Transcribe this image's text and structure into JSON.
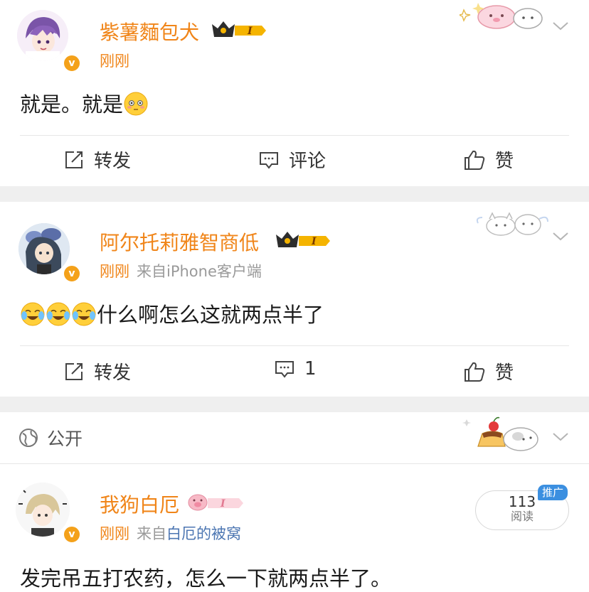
{
  "posts": [
    {
      "username": "紫薯麵包犬",
      "vip_level": "I",
      "time": "刚刚",
      "source_prefix": "",
      "source": "",
      "text": "就是。就是",
      "actions": {
        "repost": "转发",
        "comment": "评论",
        "like": "赞"
      }
    },
    {
      "username": "阿尔托莉雅智商低",
      "vip_level": "I",
      "time": "刚刚",
      "source_prefix": "来自",
      "source": "iPhone客户端",
      "text": "什么啊怎么这就两点半了",
      "actions": {
        "repost": "转发",
        "comment": "1",
        "like": "赞"
      }
    }
  ],
  "visibility": {
    "label": "公开"
  },
  "post3": {
    "username": "我狗白厄",
    "vip_level": "I",
    "time": "刚刚",
    "source_prefix": "来自",
    "source": "白厄的被窝",
    "text": "发完吊五打农药，怎么一下就两点半了。",
    "reads_count": "113",
    "reads_label": "阅读",
    "promo_badge": "推广"
  },
  "colors": {
    "username": "#f08519",
    "vip_gold": "#f5b400",
    "link": "#4c76b2",
    "promo": "#3b8fe0",
    "separator": "#efefef"
  },
  "icons": {
    "repost": "repost-icon",
    "comment": "comment-icon",
    "like": "thumbs-up-icon",
    "verified": "verified-v-icon",
    "globe": "globe-icon",
    "chevron": "chevron-down-icon"
  }
}
